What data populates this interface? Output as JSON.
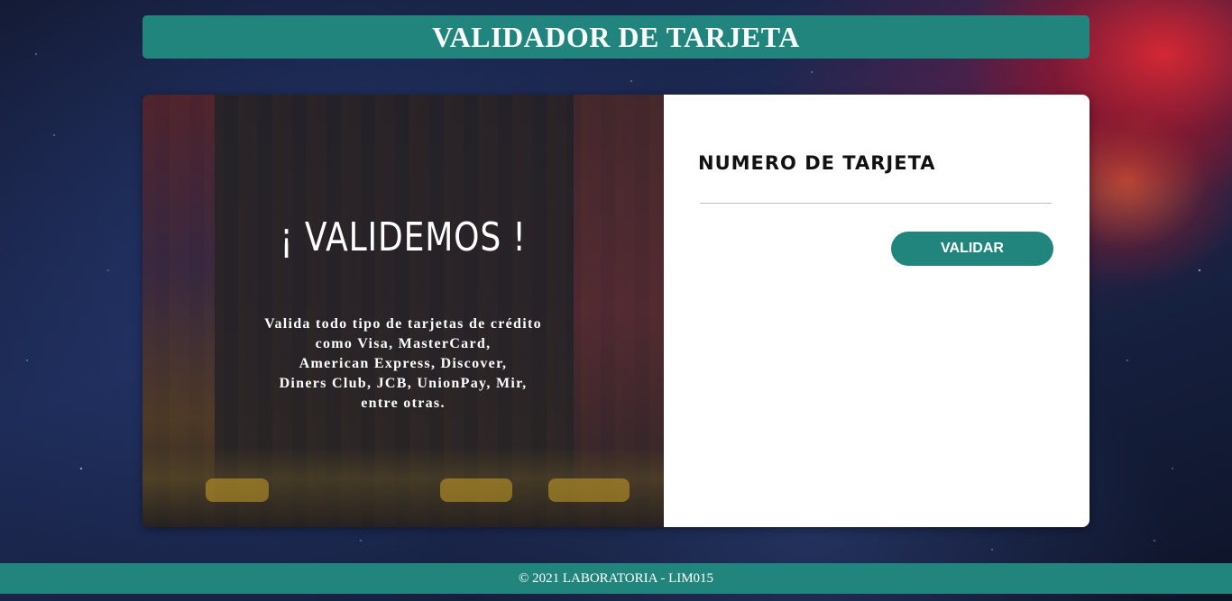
{
  "header": {
    "title": "VALIDADOR DE TARJETA"
  },
  "intro": {
    "title": "¡ VALIDEMOS !",
    "description_lines": [
      "Valida todo tipo de tarjetas de crédito",
      "como Visa, MasterCard,",
      "American Express, Discover,",
      "Diners Club, JCB, UnionPay, Mir,",
      "entre otras."
    ]
  },
  "form": {
    "card_number_label": "NUMERO DE TARJETA",
    "card_number_value": "",
    "validate_label": "VALIDAR"
  },
  "footer": {
    "text": "© 2021 LABORATORIA - LIM015"
  },
  "colors": {
    "accent": "#21847d",
    "panel_white": "#ffffff"
  }
}
